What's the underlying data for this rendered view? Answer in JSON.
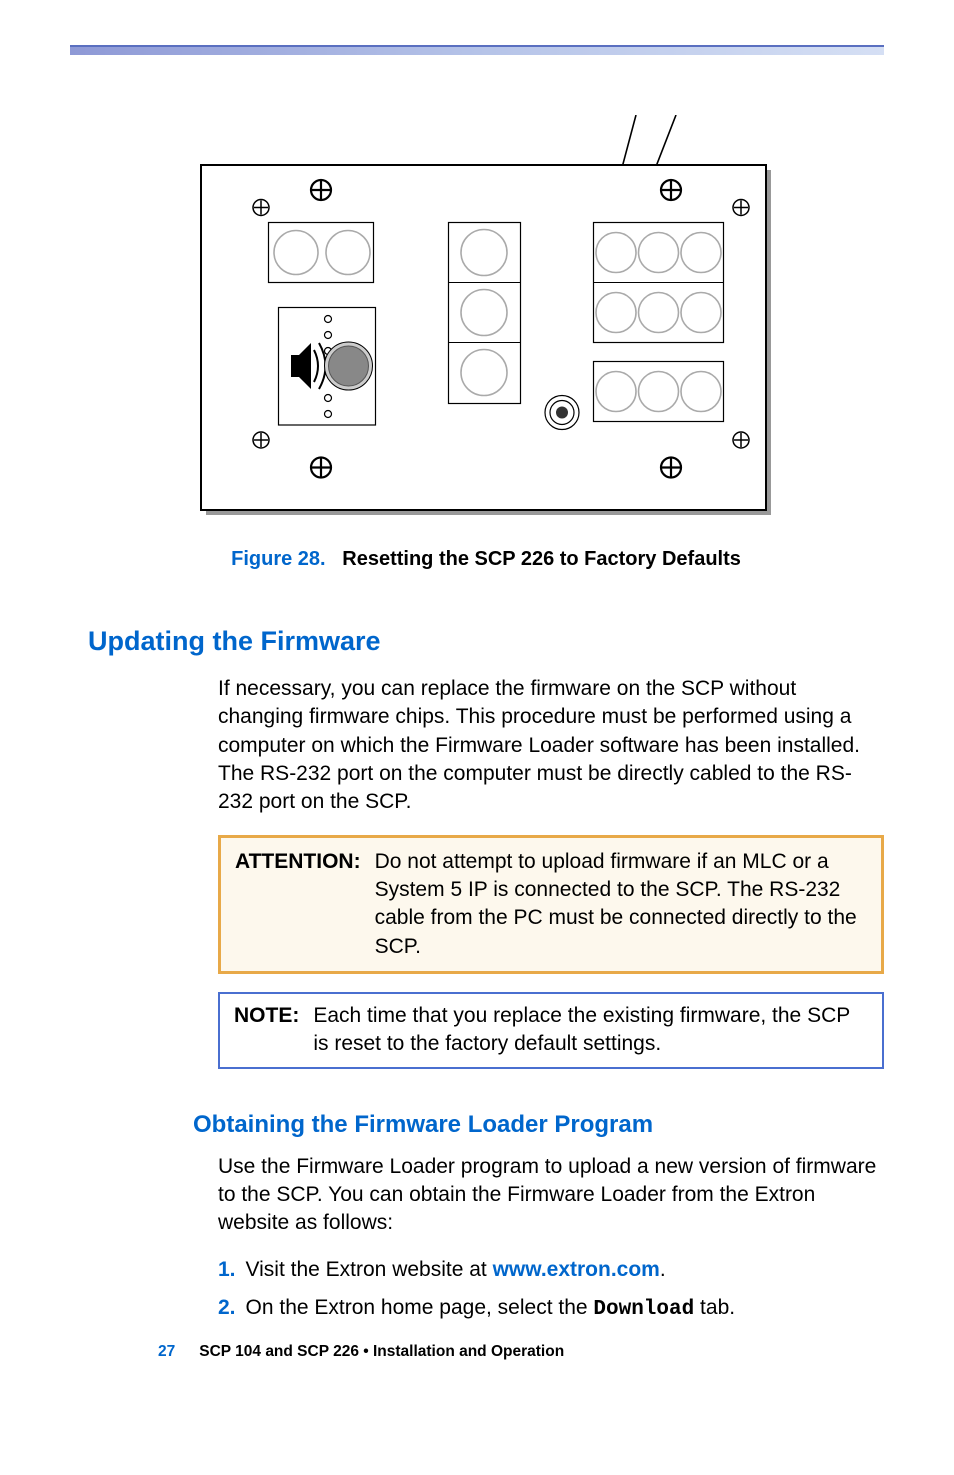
{
  "figure": {
    "label": "Figure 28.",
    "caption": "Resetting the SCP 226 to Factory Defaults"
  },
  "section": {
    "title": "Updating the Firmware",
    "body": "If necessary, you can replace the firmware on the SCP without changing firmware chips. This procedure must be performed using a computer on which the Firmware Loader software has been installed. The RS-232 port on the computer must be directly cabled to the RS-232 port on the SCP."
  },
  "attention": {
    "label": "ATTENTION:",
    "text": "Do not attempt to upload firmware if an MLC or a System 5 IP is connected to the SCP. The RS-232 cable from the PC must be connected directly to the SCP."
  },
  "note": {
    "label": "NOTE:",
    "text": "Each time that you replace the existing firmware, the SCP is reset to the factory default settings."
  },
  "subsection": {
    "title": "Obtaining the Firmware Loader Program",
    "body": "Use the Firmware Loader program to upload a new version of firmware to the SCP. You can obtain the Firmware Loader from the Extron website as follows:"
  },
  "steps": [
    {
      "num": "1.",
      "pre": "Visit the Extron website at ",
      "link": "www.extron.com",
      "post": "."
    },
    {
      "num": "2.",
      "pre": "On the Extron home page, select the ",
      "code": "Download",
      "post": " tab."
    }
  ],
  "footer": {
    "page": "27",
    "text": "SCP 104 and SCP 226 • Installation and Operation"
  }
}
